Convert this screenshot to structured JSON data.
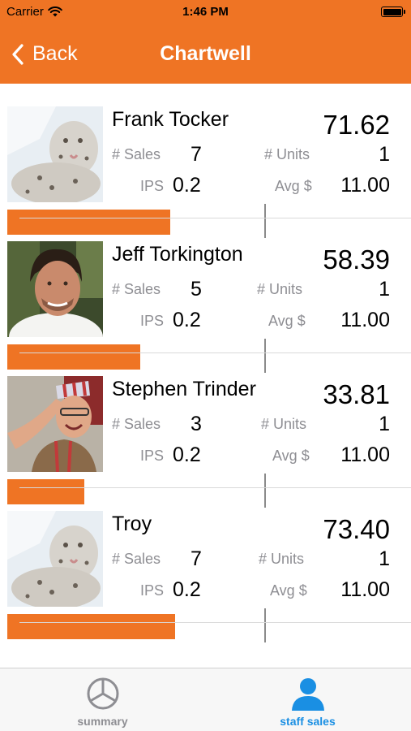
{
  "status_bar": {
    "carrier": "Carrier",
    "time": "1:46 PM"
  },
  "nav": {
    "back_label": "Back",
    "title": "Chartwell"
  },
  "colors": {
    "accent": "#ef7424",
    "tab_active": "#1a8fe3",
    "tab_inactive": "#8e8e93"
  },
  "labels": {
    "sales": "# Sales",
    "units": "# Units",
    "ips": "IPS",
    "avg": "Avg $"
  },
  "staff": [
    {
      "name": "Frank Tocker",
      "total": "71.62",
      "sales": "7",
      "units": "1",
      "ips": "0.2",
      "avg": "11.00",
      "photo": "snow-leopard",
      "bar_fraction": 0.97
    },
    {
      "name": "Jeff Torkington",
      "total": "58.39",
      "sales": "5",
      "units": "1",
      "ips": "0.2",
      "avg": "11.00",
      "photo": "man-portrait",
      "bar_fraction": 0.79
    },
    {
      "name": "Stephen Trinder",
      "total": "33.81",
      "sales": "3",
      "units": "1",
      "ips": "0.2",
      "avg": "11.00",
      "photo": "man-party-hat",
      "bar_fraction": 0.46
    },
    {
      "name": "Troy",
      "total": "73.40",
      "sales": "7",
      "units": "1",
      "ips": "0.2",
      "avg": "11.00",
      "photo": "snow-leopard",
      "bar_fraction": 1.0
    }
  ],
  "tabs": [
    {
      "label": "summary",
      "icon": "pie-chart-icon",
      "active": false
    },
    {
      "label": "staff sales",
      "icon": "person-icon",
      "active": true
    }
  ]
}
